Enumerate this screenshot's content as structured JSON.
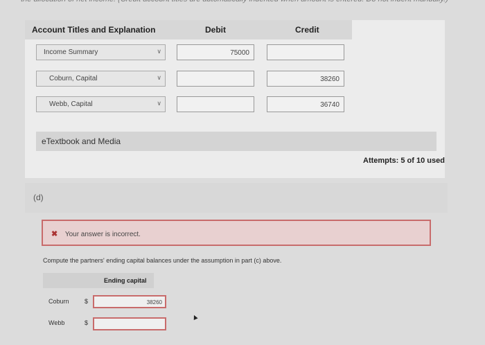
{
  "top_note": "the allocation of net income. (Credit account titles are automatically indented when amount is entered. Do not indent manually.)",
  "table": {
    "headers": {
      "account": "Account Titles and Explanation",
      "debit": "Debit",
      "credit": "Credit"
    },
    "rows": [
      {
        "account": "Income Summary",
        "debit": "75000",
        "credit": ""
      },
      {
        "account": "Coburn, Capital",
        "debit": "",
        "credit": "38260"
      },
      {
        "account": "Webb, Capital",
        "debit": "",
        "credit": "36740"
      }
    ]
  },
  "etextbook_label": "eTextbook and Media",
  "attempts": "Attempts: 5 of 10 used",
  "part_label": "(d)",
  "error": {
    "icon": "x-icon",
    "message": "Your answer is incorrect."
  },
  "instruction": "Compute the partners' ending capital balances under the assumption in part (c) above.",
  "ending_capital": {
    "header": "Ending capital",
    "currency": "$",
    "rows": [
      {
        "name": "Coburn",
        "value": "38260"
      },
      {
        "name": "Webb",
        "value": ""
      }
    ]
  },
  "colors": {
    "error_border": "#c86b6b",
    "error_bg": "#e8d0d0"
  }
}
